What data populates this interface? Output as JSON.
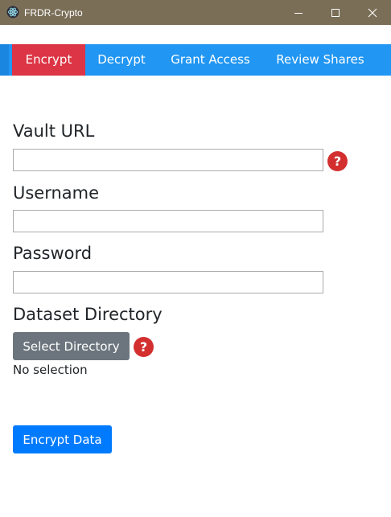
{
  "window": {
    "title": "FRDR-Crypto",
    "titlebar_color": "#7a6e57",
    "controls": [
      "minimize-icon",
      "maximize-icon",
      "close-icon"
    ]
  },
  "nav": {
    "tabs": [
      {
        "label": "Encrypt",
        "active": true
      },
      {
        "label": "Decrypt",
        "active": false
      },
      {
        "label": "Grant Access",
        "active": false
      },
      {
        "label": "Review Shares",
        "active": false
      }
    ],
    "bar_color": "#2196f3",
    "active_color": "#dc3545"
  },
  "form": {
    "vault_url": {
      "label": "Vault URL",
      "value": "",
      "help": "?"
    },
    "username": {
      "label": "Username",
      "value": ""
    },
    "password": {
      "label": "Password",
      "value": ""
    },
    "dataset_directory": {
      "label": "Dataset Directory",
      "button_label": "Select Directory",
      "help": "?",
      "selection_text": "No selection"
    },
    "submit_label": "Encrypt Data"
  }
}
